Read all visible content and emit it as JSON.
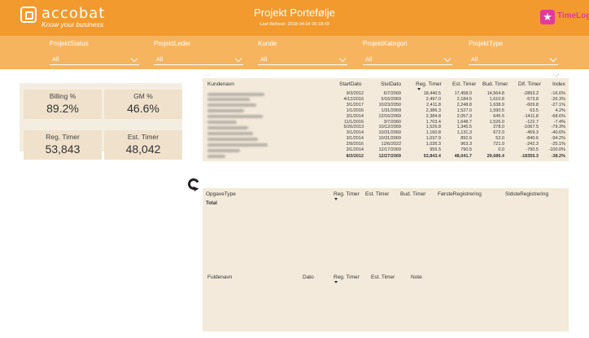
{
  "header": {
    "logo_name": "accobat",
    "logo_tagline": "Know your business",
    "title": "Projekt Portefølje",
    "refresh": "Last Refresh: 2018-04-04 06:18:49",
    "timelog_label": "TimeLog",
    "accent_color": "#f29a2e",
    "timelog_color": "#e23a9a"
  },
  "filters": [
    {
      "label": "ProjektStatus",
      "value": "All"
    },
    {
      "label": "ProjektLeder",
      "value": "All"
    },
    {
      "label": "Kunde",
      "value": "All"
    },
    {
      "label": "ProjektKategori",
      "value": "All"
    },
    {
      "label": "ProjektType",
      "value": "All"
    }
  ],
  "kpis": [
    {
      "label": "Billing %",
      "value": "89.2%"
    },
    {
      "label": "GM %",
      "value": "46.6%"
    },
    {
      "label": "Reg. Timer",
      "value": "53,843"
    },
    {
      "label": "Est. Timer",
      "value": "48,042"
    }
  ],
  "main_table": {
    "columns": [
      "Kundenavn",
      "StartDato",
      "SlutDato",
      "Reg. Timer",
      "Est. Timer",
      "Bud. Timer",
      "Dif. Timer",
      "Index"
    ],
    "rows": [
      [
        "9/3/2012",
        "6/7/2069",
        "18,440.5",
        "17,458.0",
        "14,564.8",
        "-2893.2",
        "-16.6%"
      ],
      [
        "4/12/2016",
        "5/16/2069",
        "2,497.0",
        "2,184.5",
        "1,610.8",
        "-573.8",
        "-26.3%"
      ],
      [
        "3/1/2017",
        "10/23/2050",
        "2,411.8",
        "2,248.8",
        "1,638.9",
        "-609.8",
        "-27.1%"
      ],
      [
        "1/1/2016",
        "1/31/2069",
        "2,386.3",
        "1,527.0",
        "1,590.5",
        "63.5",
        "4.2%"
      ],
      [
        "3/1/2014",
        "12/16/2069",
        "2,384.8",
        "2,057.3",
        "645.5",
        "-1411.8",
        "-68.6%"
      ],
      [
        "11/1/2016",
        "3/7/2060",
        "1,703.4",
        "1,648.7",
        "1,526.0",
        "-122.7",
        "-7.4%"
      ],
      [
        "5/26/2013",
        "10/12/2069",
        "1,526.8",
        "1,345.5",
        "278.0",
        "-1067.5",
        "-79.3%"
      ],
      [
        "3/1/2014",
        "10/31/2069",
        "1,160.8",
        "1,131.3",
        "672.0",
        "-459.3",
        "-40.6%"
      ],
      [
        "3/1/2014",
        "10/31/2069",
        "1,037.9",
        "892.6",
        "52.0",
        "-840.6",
        "-94.2%"
      ],
      [
        "2/9/2016",
        "12/6/2022",
        "1,035.3",
        "963.3",
        "721.0",
        "-242.3",
        "-25.1%"
      ],
      [
        "3/1/2014",
        "12/17/2069",
        "955.5",
        "790.5",
        "0.0",
        "-790.5",
        "-100.0%"
      ]
    ],
    "total": [
      "8/3/2012",
      "12/27/2069",
      "53,843.4",
      "48,041.7",
      "29,686.4",
      "-18355.3",
      "-38.2%"
    ]
  },
  "sub_table": {
    "columns": [
      "OpgaveType",
      "Reg. Timer",
      "Est. Timer",
      "Bud. Timer",
      "FørsteRegistrering",
      "SidsteRegistrering"
    ],
    "total_label": "Total"
  },
  "detail_table": {
    "columns": [
      "Fuldenavn",
      "Dato",
      "Reg. Timer",
      "Est. Timer",
      "Note"
    ]
  }
}
